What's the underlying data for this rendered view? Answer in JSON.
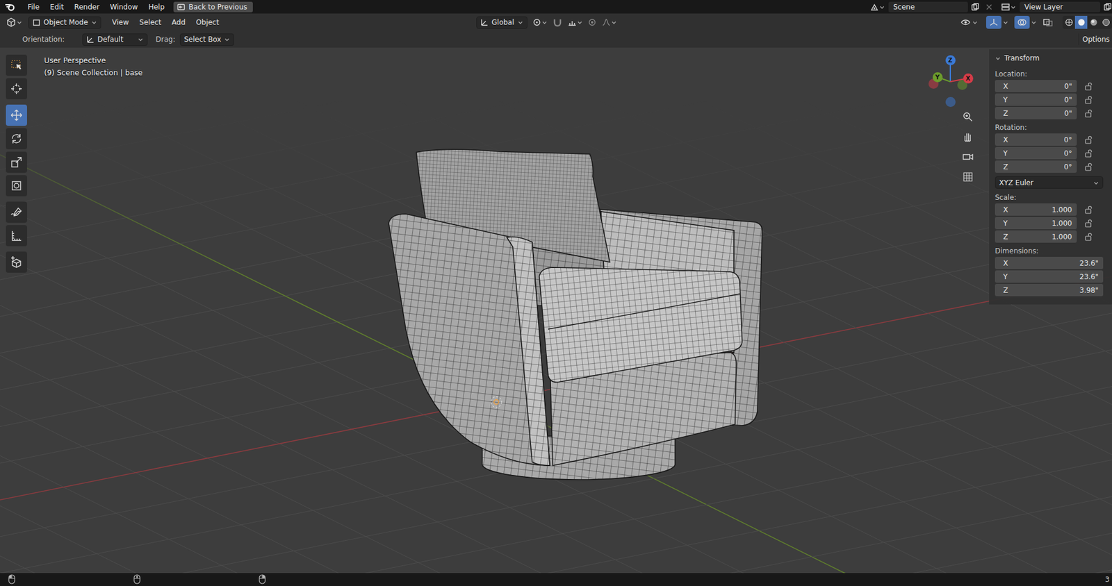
{
  "menu_bar": {
    "menus": [
      "File",
      "Edit",
      "Render",
      "Window",
      "Help"
    ],
    "back_button": "Back to Previous",
    "scene": "Scene",
    "view_layer": "View Layer"
  },
  "header": {
    "mode": "Object Mode",
    "menus": [
      "View",
      "Select",
      "Add",
      "Object"
    ],
    "transform_orientation": "Global",
    "gizmos_on": true,
    "overlays_on": true,
    "shading": [
      {
        "kind": "wireframe",
        "selected": false
      },
      {
        "kind": "solid",
        "selected": true
      },
      {
        "kind": "material",
        "selected": false
      },
      {
        "kind": "rendered",
        "selected": false
      }
    ]
  },
  "tool_settings": {
    "orientation_label": "Orientation:",
    "orientation": "Default",
    "drag_label": "Drag:",
    "drag": "Select Box",
    "options_tab": "Options"
  },
  "toolbar": [
    {
      "kind": "select",
      "selected": false
    },
    {
      "kind": "cursor",
      "selected": false
    },
    {
      "kind": "move",
      "selected": true
    },
    {
      "kind": "rotate",
      "selected": false
    },
    {
      "kind": "scale",
      "selected": false
    },
    {
      "kind": "transform",
      "selected": false
    },
    {
      "kind": "annotate",
      "selected": false
    },
    {
      "kind": "measure",
      "selected": false
    },
    {
      "kind": "add-cube",
      "selected": false
    }
  ],
  "viewport": {
    "view": "User Perspective",
    "collection": "(9) Scene Collection | base"
  },
  "gizmo": [
    {
      "label": "Z",
      "color": "#3b7ad6"
    },
    {
      "label": "Y",
      "color": "#6c9c2c"
    },
    {
      "label": "X",
      "color": "#d63c48"
    }
  ],
  "sidebar": {
    "title": "Transform",
    "expanded": true,
    "sections": [
      {
        "kind": "lockable",
        "label": "Location:",
        "fields": [
          {
            "axis": "X",
            "value": "0\""
          },
          {
            "axis": "Y",
            "value": "0\""
          },
          {
            "axis": "Z",
            "value": "0\""
          }
        ]
      },
      {
        "kind": "lockable",
        "label": "Rotation:",
        "fields": [
          {
            "axis": "X",
            "value": "0°"
          },
          {
            "axis": "Y",
            "value": "0°"
          },
          {
            "axis": "Z",
            "value": "0°"
          }
        ]
      },
      {
        "kind": "dropdown",
        "value": "XYZ Euler"
      },
      {
        "kind": "lockable",
        "label": "Scale:",
        "fields": [
          {
            "axis": "X",
            "value": "1.000"
          },
          {
            "axis": "Y",
            "value": "1.000"
          },
          {
            "axis": "Z",
            "value": "1.000"
          }
        ]
      },
      {
        "kind": "plain",
        "label": "Dimensions:",
        "fields": [
          {
            "axis": "X",
            "value": "23.6\""
          },
          {
            "axis": "Y",
            "value": "23.6\""
          },
          {
            "axis": "Z",
            "value": "3.98\""
          }
        ]
      }
    ]
  },
  "status_bar": {
    "version": "3"
  }
}
